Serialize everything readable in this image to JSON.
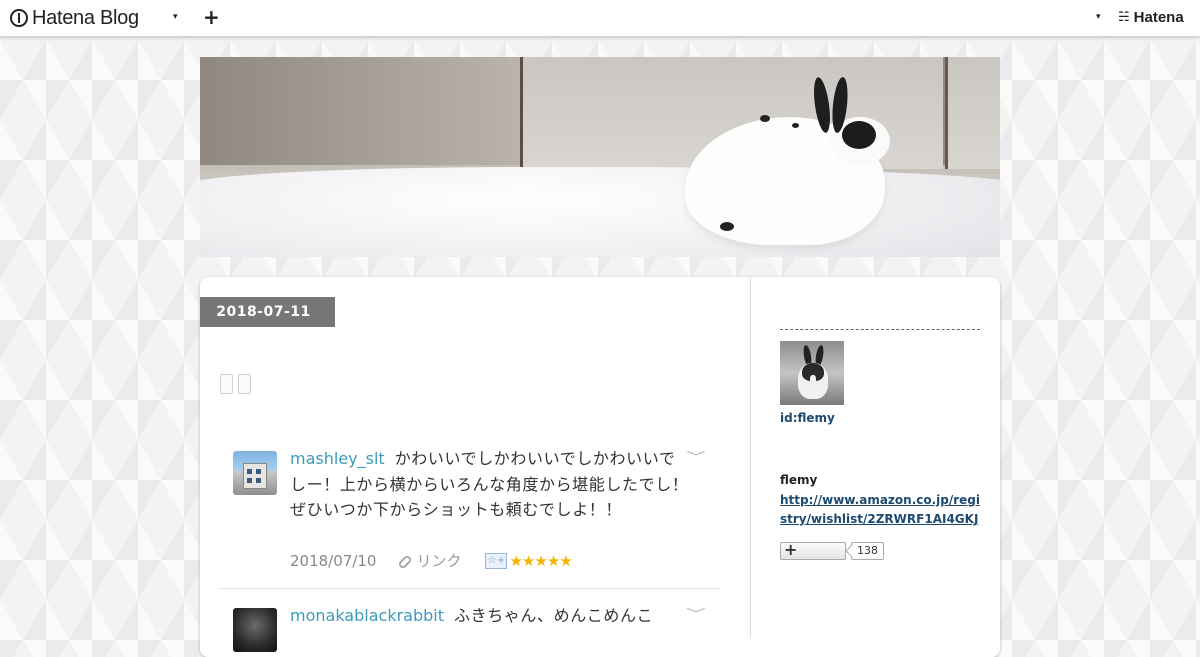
{
  "global_header": {
    "logo_text": "Hatena Blog",
    "caret": "▾",
    "plus": "+",
    "brand_text": "Hatena",
    "icons": [
      "hatena-blog-logo-icon",
      "caret-down-icon",
      "plus-icon",
      "hatena-logo-icon"
    ]
  },
  "entry": {
    "date": "2018-07-11"
  },
  "comments": [
    {
      "user": "mashley_slt",
      "text": "かわいいでしかわいいでしかわいいでしー！上から横からいろんな角度から堪能したでし！ぜひいつか下からショットも頼むでしよ！！",
      "date": "2018/07/10",
      "link_label": "リンク",
      "stars": "★★★★★",
      "star_count": 5
    },
    {
      "user": "monakablackrabbit",
      "text": "ふきちゃん、めんこめんこ",
      "date": "",
      "link_label": "",
      "stars": ""
    }
  ],
  "sidebar": {
    "profile_id": "id:flemy",
    "name": "flemy",
    "link": "http://www.amazon.co.jp/registry/wishlist/2ZRWRF1AI4GKJ",
    "subscribe_plus": "+",
    "subscriber_count": "138"
  }
}
